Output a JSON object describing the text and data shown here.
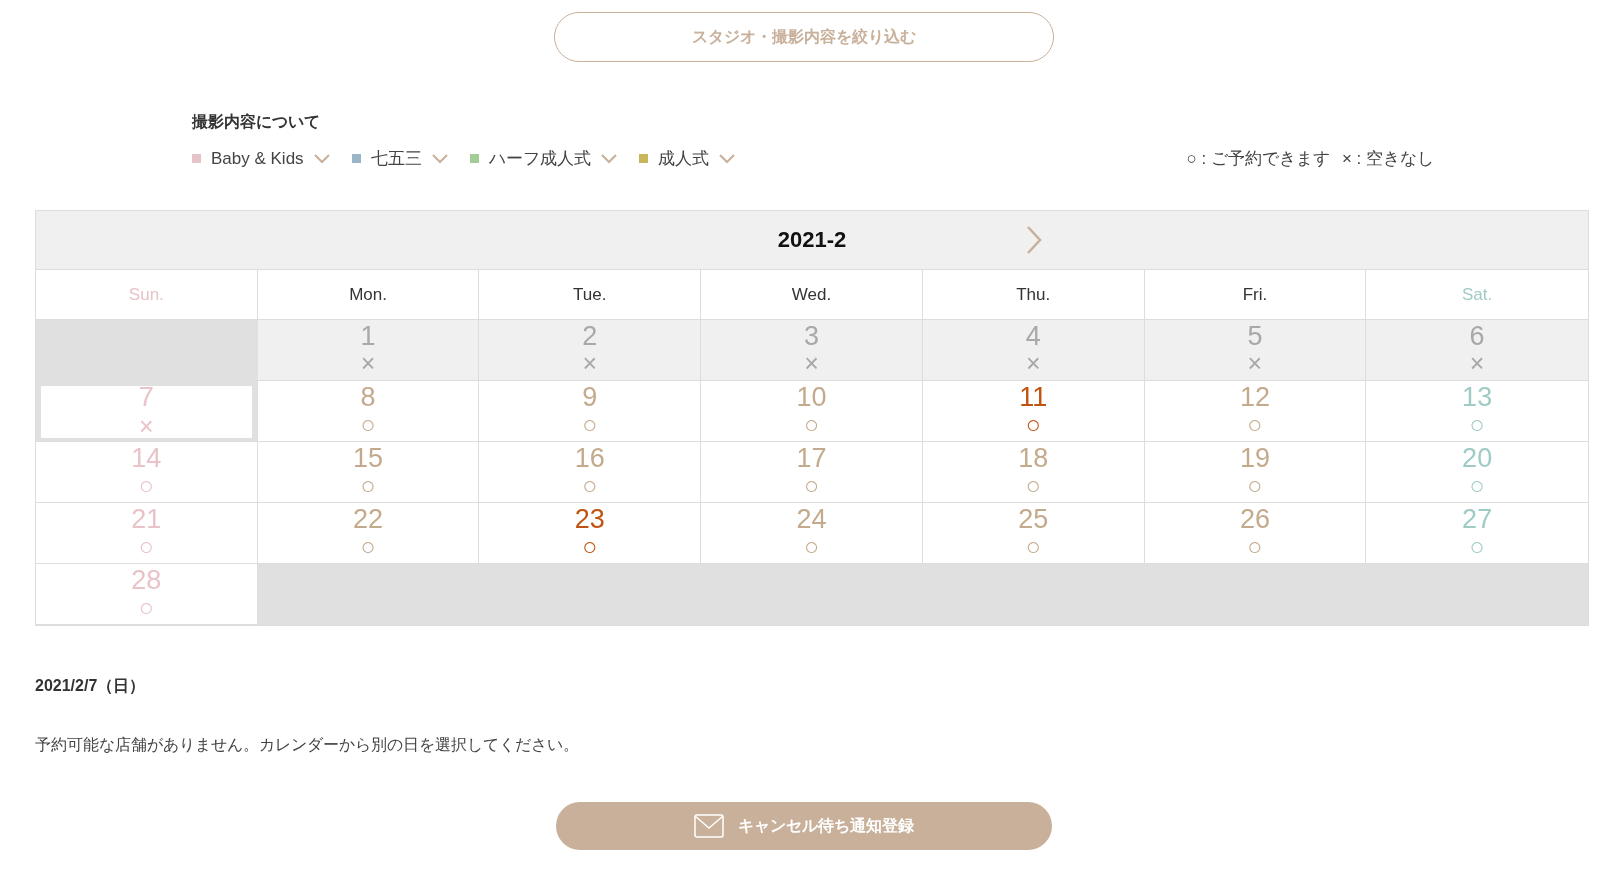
{
  "filter_button": {
    "label": "スタジオ・撮影内容を絞り込む"
  },
  "shoot_types": {
    "title": "撮影内容について",
    "items": [
      {
        "label": "Baby & Kids",
        "color": "#e6c3c8"
      },
      {
        "label": "七五三",
        "color": "#9ab5c8"
      },
      {
        "label": "ハーフ成人式",
        "color": "#a3cc97"
      },
      {
        "label": "成人式",
        "color": "#c9b65c"
      }
    ]
  },
  "availability_legend": [
    "○ : ご予約できます",
    "× : 空きなし"
  ],
  "calendar": {
    "month": "2021-2",
    "weekdays": [
      "Sun.",
      "Mon.",
      "Tue.",
      "Wed.",
      "Thu.",
      "Fri.",
      "Sat."
    ],
    "weeks": [
      [
        {
          "kind": "empty"
        },
        {
          "kind": "past",
          "day": "1",
          "mark": "×"
        },
        {
          "kind": "past",
          "day": "2",
          "mark": "×"
        },
        {
          "kind": "past",
          "day": "3",
          "mark": "×"
        },
        {
          "kind": "past",
          "day": "4",
          "mark": "×"
        },
        {
          "kind": "past",
          "day": "5",
          "mark": "×"
        },
        {
          "kind": "past",
          "day": "6",
          "mark": "×"
        }
      ],
      [
        {
          "kind": "day",
          "day": "7",
          "mark": "×",
          "selected": true,
          "holiday": false
        },
        {
          "kind": "day",
          "day": "8",
          "mark": "○",
          "selected": false,
          "holiday": false
        },
        {
          "kind": "day",
          "day": "9",
          "mark": "○",
          "selected": false,
          "holiday": false
        },
        {
          "kind": "day",
          "day": "10",
          "mark": "○",
          "selected": false,
          "holiday": false
        },
        {
          "kind": "day",
          "day": "11",
          "mark": "○",
          "selected": false,
          "holiday": true
        },
        {
          "kind": "day",
          "day": "12",
          "mark": "○",
          "selected": false,
          "holiday": false
        },
        {
          "kind": "day",
          "day": "13",
          "mark": "○",
          "selected": false,
          "holiday": false
        }
      ],
      [
        {
          "kind": "day",
          "day": "14",
          "mark": "○",
          "selected": false,
          "holiday": false
        },
        {
          "kind": "day",
          "day": "15",
          "mark": "○",
          "selected": false,
          "holiday": false
        },
        {
          "kind": "day",
          "day": "16",
          "mark": "○",
          "selected": false,
          "holiday": false
        },
        {
          "kind": "day",
          "day": "17",
          "mark": "○",
          "selected": false,
          "holiday": false
        },
        {
          "kind": "day",
          "day": "18",
          "mark": "○",
          "selected": false,
          "holiday": false
        },
        {
          "kind": "day",
          "day": "19",
          "mark": "○",
          "selected": false,
          "holiday": false
        },
        {
          "kind": "day",
          "day": "20",
          "mark": "○",
          "selected": false,
          "holiday": false
        }
      ],
      [
        {
          "kind": "day",
          "day": "21",
          "mark": "○",
          "selected": false,
          "holiday": false
        },
        {
          "kind": "day",
          "day": "22",
          "mark": "○",
          "selected": false,
          "holiday": false
        },
        {
          "kind": "day",
          "day": "23",
          "mark": "○",
          "selected": false,
          "holiday": true
        },
        {
          "kind": "day",
          "day": "24",
          "mark": "○",
          "selected": false,
          "holiday": false
        },
        {
          "kind": "day",
          "day": "25",
          "mark": "○",
          "selected": false,
          "holiday": false
        },
        {
          "kind": "day",
          "day": "26",
          "mark": "○",
          "selected": false,
          "holiday": false
        },
        {
          "kind": "day",
          "day": "27",
          "mark": "○",
          "selected": false,
          "holiday": false
        }
      ],
      [
        {
          "kind": "day",
          "day": "28",
          "mark": "○",
          "selected": false,
          "holiday": false
        },
        {
          "kind": "empty"
        },
        {
          "kind": "empty"
        },
        {
          "kind": "empty"
        },
        {
          "kind": "empty"
        },
        {
          "kind": "empty"
        },
        {
          "kind": "empty"
        }
      ]
    ]
  },
  "result": {
    "date": "2021/2/7（日）",
    "message": "予約可能な店舗がありません。カレンダーから別の日を選択してください。"
  },
  "notify_button": {
    "label": "キャンセル待ち通知登録"
  }
}
